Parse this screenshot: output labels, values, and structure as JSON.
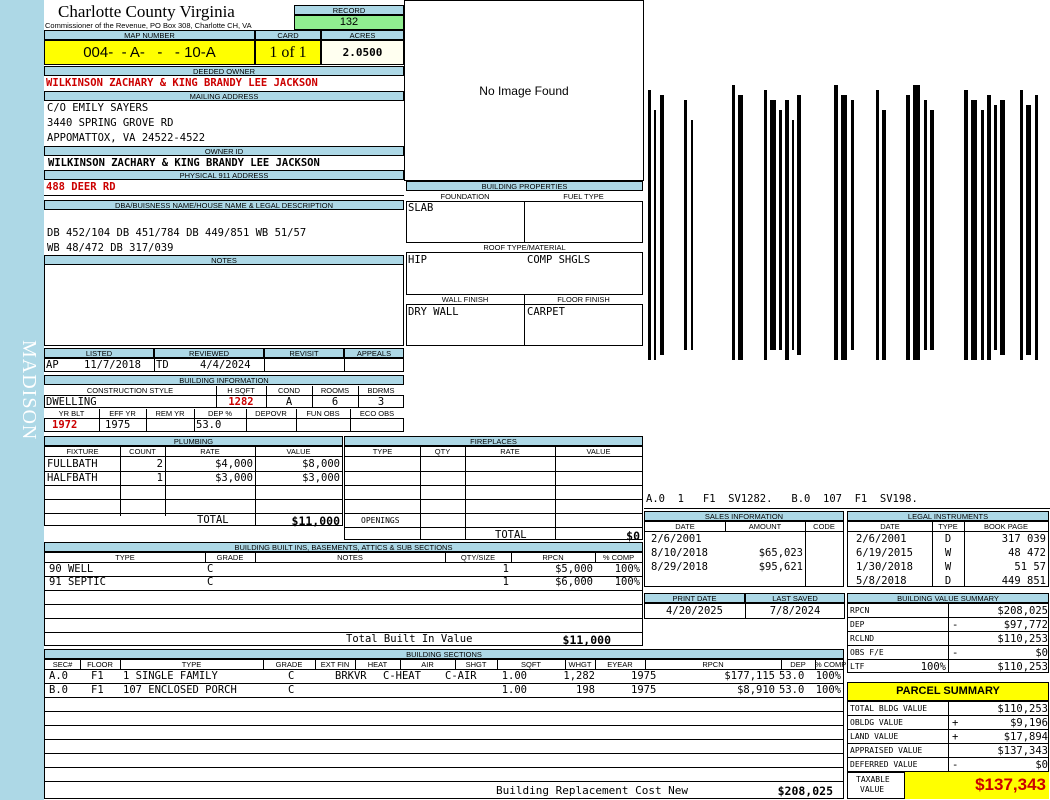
{
  "sidebar": {
    "district": "MADISON",
    "color": "#add8e6"
  },
  "header": {
    "county": "Charlotte County Virginia",
    "office": "Commissioner of the Revenue, PO Box 308, Charlotte CH, VA",
    "record_label": "RECORD",
    "record": "132",
    "map_label": "MAP NUMBER",
    "map_number": "004-  - A-   -   - 10-A",
    "card_label": "CARD",
    "card": "1 of 1",
    "acres_label": "ACRES",
    "acres": "2.0500"
  },
  "owner": {
    "deeded_label": "DEEDED OWNER",
    "deeded": "WILKINSON ZACHARY & KING BRANDY LEE JACKSON",
    "mailing_label": "MAILING ADDRESS",
    "mailing": [
      "C/O  EMILY SAYERS",
      "3440 SPRING GROVE RD",
      "APPOMATTOX, VA 24522-4522"
    ],
    "ownerid_label": "OWNER ID",
    "ownerid": "WILKINSON ZACHARY & KING BRANDY LEE JACKSON",
    "address_label": "PHYSICAL 911 ADDRESS",
    "address": "488 DEER RD",
    "legal_label": "DBA/BUISNESS NAME/HOUSE NAME & LEGAL DESCRIPTION",
    "legal": [
      "DB 452/104 DB 451/784 DB 449/851 WB 51/57",
      "WB 48/472 DB 317/039"
    ],
    "notes_label": "NOTES"
  },
  "photo": {
    "text": "No Image Found"
  },
  "building_props": {
    "title": "BUILDING PROPERTIES",
    "foundation_label": "FOUNDATION",
    "foundation": "SLAB",
    "fuel_label": "FUEL TYPE",
    "fuel": "",
    "roof_label": "ROOF TYPE/MATERIAL",
    "roof_type": "HIP",
    "roof_material": "COMP SHGLS",
    "wall_label": "WALL FINISH",
    "wall": "DRY WALL",
    "floor_label": "FLOOR FINISH",
    "floor": "CARPET"
  },
  "sketch": {
    "legend": "A.0  1   F1  SV1282.   B.0  107  F1  SV198."
  },
  "status": {
    "listed_label": "LISTED",
    "listed_code": "AP",
    "listed": "11/7/2018",
    "reviewed_label": "REVIEWED",
    "reviewed_code": "TD",
    "reviewed": "4/4/2024",
    "revisit_label": "REVISIT",
    "appeals_label": "APPEALS"
  },
  "building_info": {
    "title": "BUILDING INFORMATION",
    "style_label": "CONSTRUCTION STYLE",
    "style": "DWELLING",
    "hsqft_label": "H SQFT",
    "hsqft": "1282",
    "cond_label": "COND",
    "cond": "A",
    "rooms_label": "ROOMS",
    "rooms": "6",
    "bdrms_label": "BDRMS",
    "bdrms": "3",
    "yrblt_label": "YR BLT",
    "yrblt": "1972",
    "effyr_label": "EFF YR",
    "effyr": "1975",
    "remyr_label": "REM YR",
    "remyr": "",
    "dep_label": "DEP %",
    "dep": "53.0",
    "depovr_label": "DEPOVR",
    "funobs_label": "FUN OBS",
    "ecoobs_label": "ECO OBS"
  },
  "plumbing": {
    "title": "PLUMBING",
    "headers": [
      "FIXTURE",
      "COUNT",
      "RATE",
      "VALUE"
    ],
    "rows": [
      [
        "FULLBATH",
        "2",
        "$4,000",
        "$8,000"
      ],
      [
        "HALFBATH",
        "1",
        "$3,000",
        "$3,000"
      ]
    ],
    "total_label": "TOTAL",
    "total": "$11,000"
  },
  "fireplaces": {
    "title": "FIREPLACES",
    "headers": [
      "TYPE",
      "QTY",
      "RATE",
      "VALUE"
    ],
    "openings_label": "OPENINGS",
    "total_label": "TOTAL",
    "total": "$0"
  },
  "sales": {
    "title": "SALES INFORMATION",
    "headers": [
      "DATE",
      "AMOUNT",
      "CODE"
    ],
    "rows": [
      [
        "2/6/2001",
        "",
        ""
      ],
      [
        "8/10/2018",
        "$65,023",
        ""
      ],
      [
        "8/29/2018",
        "$95,621",
        ""
      ]
    ]
  },
  "legal_instruments": {
    "title": "LEGAL INSTRUMENTS",
    "headers": [
      "DATE",
      "TYPE",
      "BOOK PAGE"
    ],
    "rows": [
      [
        "2/6/2001",
        "D",
        "317 039"
      ],
      [
        "6/19/2015",
        "W",
        "48 472"
      ],
      [
        "1/30/2018",
        "W",
        "51 57"
      ],
      [
        "5/8/2018",
        "D",
        "449 851"
      ]
    ]
  },
  "builtins": {
    "title": "BUILDING BUILT INS, BASEMENTS, ATTICS & SUB SECTIONS",
    "headers": [
      "TYPE",
      "GRADE",
      "NOTES",
      "QTY/SIZE",
      "RPCN",
      "% COMP"
    ],
    "rows": [
      [
        "90 WELL",
        "C",
        "",
        "1",
        "$5,000",
        "100%"
      ],
      [
        "91 SEPTIC",
        "C",
        "",
        "1",
        "$6,000",
        "100%"
      ]
    ],
    "total_label": "Total Built In Value",
    "total": "$11,000"
  },
  "print": {
    "print_label": "PRINT DATE",
    "print_date": "4/20/2025",
    "saved_label": "LAST SAVED",
    "saved_date": "7/8/2024"
  },
  "value_summary": {
    "title": "BUILDING VALUE SUMMARY",
    "rows": [
      {
        "label": "RPCN",
        "sign": "",
        "value": "$208,025"
      },
      {
        "label": "DEP",
        "sign": "-",
        "value": "$97,772"
      },
      {
        "label": "RCLND",
        "sign": "",
        "value": "$110,253"
      },
      {
        "label": "OBS F/E",
        "sign": "-",
        "value": "$0"
      },
      {
        "label": "LTF",
        "extra": "100%",
        "sign": "",
        "value": "$110,253"
      }
    ]
  },
  "sections": {
    "title": "BUILDING SECTIONS",
    "headers": [
      "SEC#",
      "FLOOR",
      "TYPE",
      "GRADE",
      "EXT FIN",
      "HEAT",
      "AIR",
      "SHGT",
      "SQFT",
      "WHGT",
      "EYEAR",
      "RPCN",
      "DEP",
      "% COMP"
    ],
    "rows": [
      [
        "A.0",
        "F1",
        "1 SINGLE FAMILY",
        "C",
        "BRKVR",
        "C-HEAT",
        "C-AIR",
        "1.00",
        "1,282",
        "",
        "1975",
        "$177,115",
        "53.0",
        "100%"
      ],
      [
        "B.0",
        "F1",
        "107 ENCLOSED PORCH",
        "C",
        "",
        "",
        "",
        "1.00",
        "198",
        "",
        "1975",
        "$8,910",
        "53.0",
        "100%"
      ]
    ],
    "replacement_label": "Building Replacement Cost New",
    "replacement": "$208,025"
  },
  "parcel": {
    "title": "PARCEL SUMMARY",
    "rows": [
      {
        "label": "TOTAL BLDG VALUE",
        "sign": "",
        "value": "$110,253"
      },
      {
        "label": "OBLDG VALUE",
        "sign": "+",
        "value": "$9,196"
      },
      {
        "label": "LAND VALUE",
        "sign": "+",
        "value": "$17,894"
      },
      {
        "label": "APPRAISED VALUE",
        "sign": "",
        "value": "$137,343"
      },
      {
        "label": "DEFERRED VALUE",
        "sign": "-",
        "value": "$0"
      }
    ],
    "taxable_label_1": "TAXABLE",
    "taxable_label_2": "VALUE",
    "taxable": "$137,343",
    "highlight_color": "#ffff00"
  }
}
